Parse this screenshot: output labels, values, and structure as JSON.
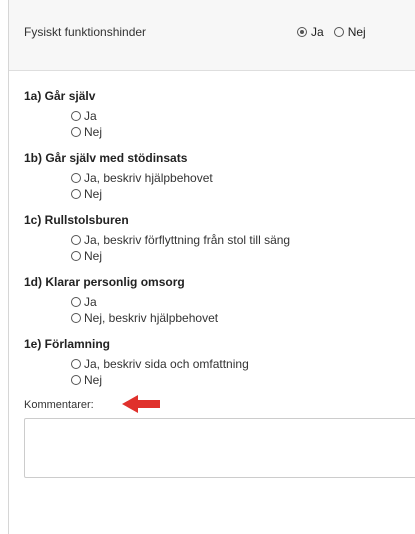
{
  "header": {
    "title": "Fysiskt funktionshinder",
    "options": [
      {
        "label": "Ja",
        "checked": true
      },
      {
        "label": "Nej",
        "checked": false
      }
    ]
  },
  "questions": [
    {
      "title": "1a) Går själv",
      "options": [
        "Ja",
        "Nej"
      ]
    },
    {
      "title": "1b) Går själv med stödinsats",
      "options": [
        "Ja, beskriv hjälpbehovet",
        "Nej"
      ]
    },
    {
      "title": "1c) Rullstolsburen",
      "options": [
        "Ja, beskriv förflyttning från stol till säng",
        "Nej"
      ]
    },
    {
      "title": "1d) Klarar personlig omsorg",
      "options": [
        "Ja",
        "Nej, beskriv hjälpbehovet"
      ]
    },
    {
      "title": "1e) Förlamning",
      "options": [
        "Ja, beskriv sida och omfattning",
        "Nej"
      ]
    }
  ],
  "comments": {
    "label": "Kommentarer:",
    "value": ""
  },
  "colors": {
    "arrow": "#e0312c"
  }
}
